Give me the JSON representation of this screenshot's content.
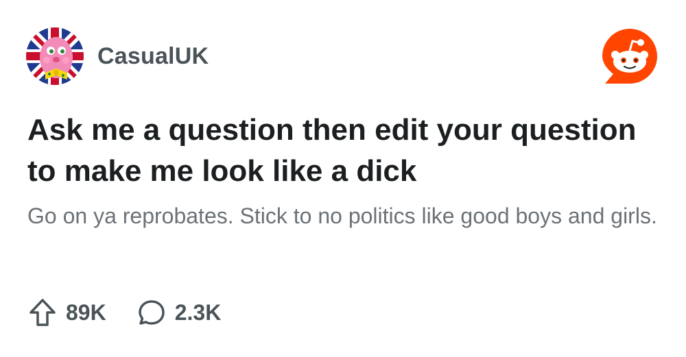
{
  "post": {
    "subreddit": "CasualUK",
    "avatar_icon": "subreddit-avatar-icon",
    "title": "Ask me a question then edit your question to make me look like a dick",
    "body": "Go on ya reprobates. Stick to no politics like good boys and girls."
  },
  "stats": {
    "upvotes": "89K",
    "comments": "2.3K",
    "upvote_icon": "upvote-arrow-icon",
    "comment_icon": "comment-bubble-icon"
  },
  "brand": {
    "logo_icon": "reddit-logo-icon",
    "accent": "#ff4500",
    "text_dark": "#1c1f21",
    "text_muted": "#6b7277"
  }
}
